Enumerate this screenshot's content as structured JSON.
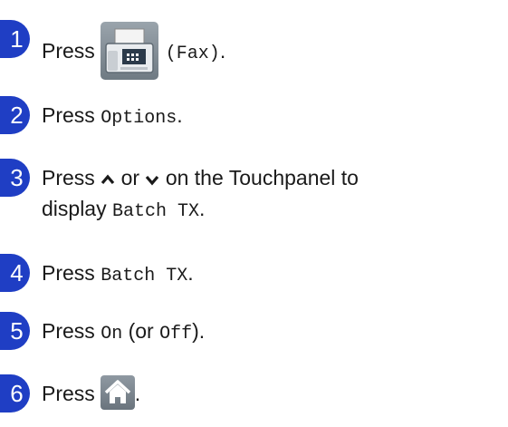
{
  "steps": [
    {
      "num": "1",
      "w1": "Press",
      "code1": "(Fax)",
      "tail": "."
    },
    {
      "num": "2",
      "w1": "Press",
      "code1": "Options",
      "tail": "."
    },
    {
      "num": "3",
      "w1": "Press",
      "up": "⌃",
      "mid": "or",
      "down": "⌄",
      "rest": "on the Touchpanel to",
      "line2": "display",
      "code1": "Batch TX",
      "tail": "."
    },
    {
      "num": "4",
      "w1": "Press",
      "code1": "Batch TX",
      "tail": "."
    },
    {
      "num": "5",
      "w1": "Press",
      "code1": "On",
      "paren": "(or",
      "code2": "Off",
      "tail": ")."
    },
    {
      "num": "6",
      "w1": "Press",
      "tail": "."
    }
  ],
  "icons": {
    "fax": "fax-machine-icon",
    "home": "home-icon",
    "up": "chevron-up-icon",
    "down": "chevron-down-icon"
  },
  "colors": {
    "step_badge": "#1f3ec4",
    "button_bg": "#7f8a93"
  }
}
